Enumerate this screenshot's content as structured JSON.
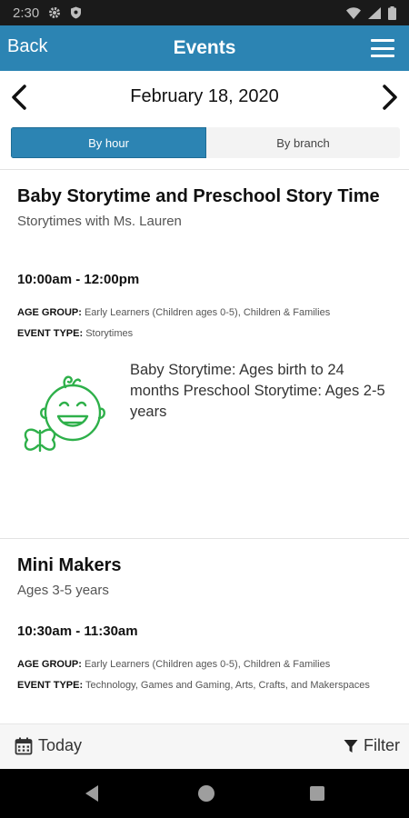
{
  "status_bar": {
    "time": "2:30",
    "icons": [
      "gear-icon",
      "shield-icon",
      "wifi-icon",
      "signal-icon",
      "battery-icon"
    ]
  },
  "app_bar": {
    "back_label": "Back",
    "title": "Events",
    "menu_icon": "hamburger-menu-icon"
  },
  "date_nav": {
    "date": "February 18, 2020",
    "prev_icon": "chevron-left-icon",
    "next_icon": "chevron-right-icon"
  },
  "view_toggle": {
    "by_hour": "By hour",
    "by_branch": "By branch",
    "selected": "By hour"
  },
  "events": [
    {
      "title": "Baby Storytime and Preschool Story Time",
      "subtitle": "Storytimes with Ms. Lauren",
      "time": "10:00am - 12:00pm",
      "age_group_label": "AGE GROUP:",
      "age_group": "Early Learners (Children ages 0-5), Children & Families",
      "event_type_label": "EVENT TYPE:",
      "event_type": "Storytimes",
      "description": "Baby Storytime: Ages birth to 24 months Preschool Storytime: Ages 2-5 years",
      "image": "baby-storytime-illustration",
      "accent_color": "#2eb04a"
    },
    {
      "title": "Mini Makers",
      "subtitle": "Ages 3-5 years",
      "time": "10:30am - 11:30am",
      "age_group_label": "AGE GROUP:",
      "age_group": "Early Learners (Children ages 0-5), Children & Families",
      "event_type_label": "EVENT TYPE:",
      "event_type": "Technology, Games and Gaming, Arts, Crafts, and Makerspaces"
    }
  ],
  "bottom_bar": {
    "today_label": "Today",
    "today_icon": "calendar-icon",
    "filter_label": "Filter",
    "filter_icon": "filter-icon"
  },
  "colors": {
    "primary": "#2c84b3",
    "status_bar": "#1a1a1a",
    "nav_bar": "#000000",
    "illustration": "#2eb04a"
  }
}
